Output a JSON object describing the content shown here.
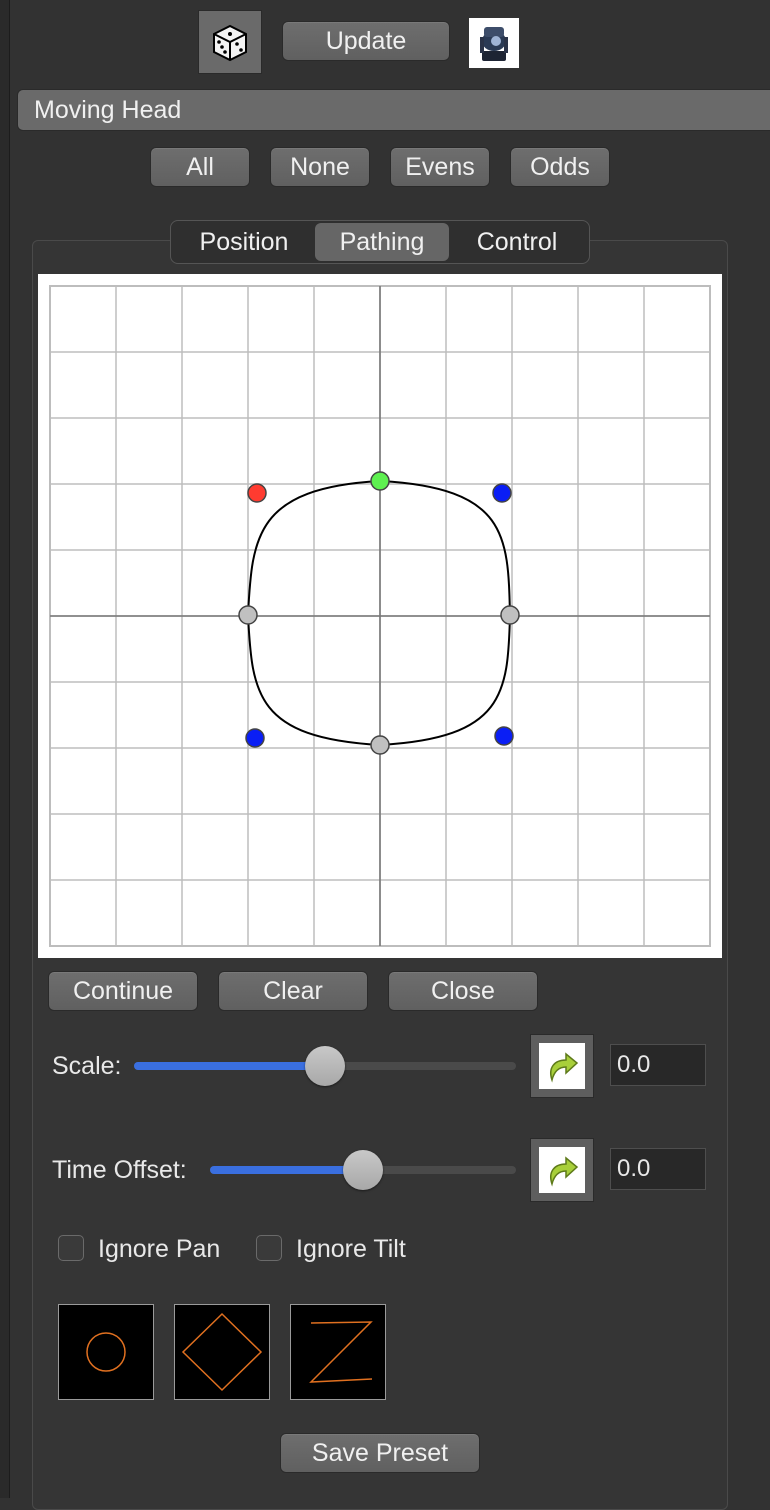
{
  "toolbar": {
    "update_label": "Update",
    "dice_icon": "dice-icon",
    "fixture_icon": "moving-head-light-icon"
  },
  "fixture": {
    "selected": "Moving Head"
  },
  "selection_buttons": [
    "All",
    "None",
    "Evens",
    "Odds"
  ],
  "tabs": [
    {
      "label": "Position",
      "active": false
    },
    {
      "label": "Pathing",
      "active": true
    },
    {
      "label": "Control",
      "active": false
    }
  ],
  "path_editor": {
    "grid_divisions": 10,
    "point_colors": {
      "start": "#ff3b30",
      "anchor_top": "#5ef050",
      "control": "#0a1ef5",
      "anchor": "#c0c0c0"
    }
  },
  "path_actions": {
    "continue_label": "Continue",
    "clear_label": "Clear",
    "close_label": "Close"
  },
  "scale": {
    "label": "Scale:",
    "value": "0.0",
    "slider_fraction": 0.5
  },
  "time_offset": {
    "label": "Time Offset:",
    "value": "0.0",
    "slider_fraction": 0.5
  },
  "options": {
    "ignore_pan_label": "Ignore Pan",
    "ignore_tilt_label": "Ignore Tilt",
    "ignore_pan": false,
    "ignore_tilt": false
  },
  "presets": [
    {
      "name": "circle-preset-icon"
    },
    {
      "name": "diamond-preset-icon"
    },
    {
      "name": "zigzag-preset-icon"
    }
  ],
  "preset_color": "#e07020",
  "save_preset_label": "Save Preset",
  "accent_color": "#3a6fe0"
}
